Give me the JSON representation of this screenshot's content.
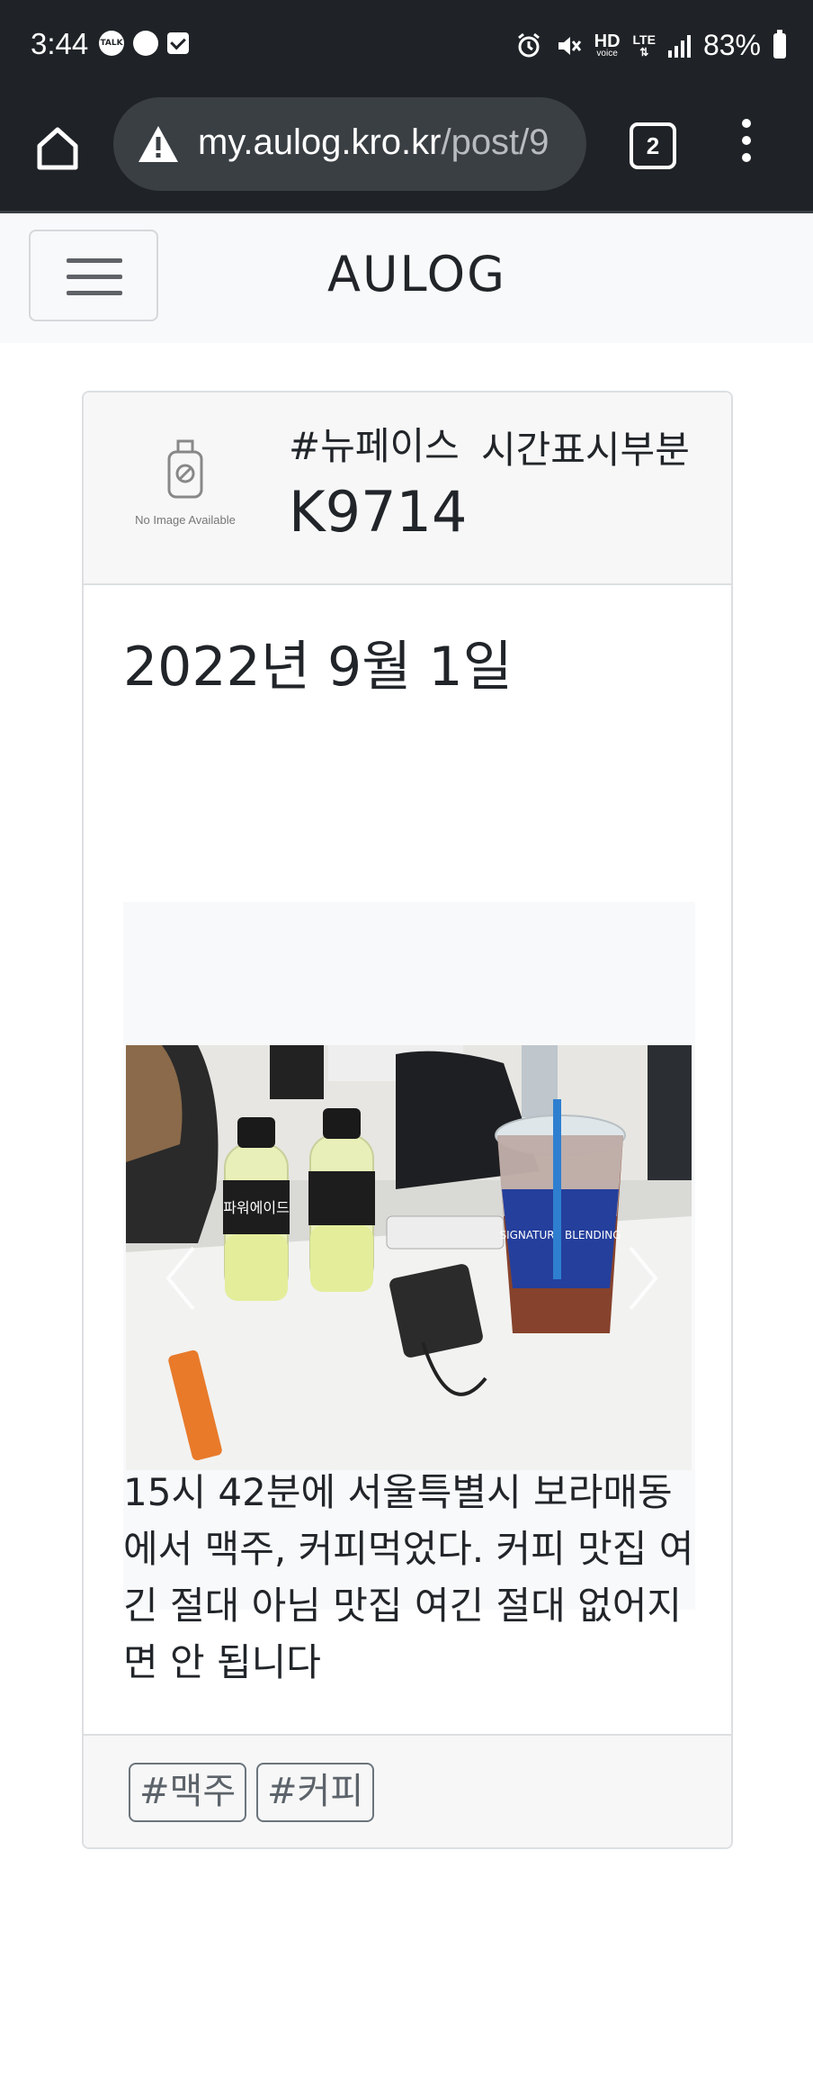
{
  "status_bar": {
    "time": "3:44",
    "talk_icon_text": "TALK",
    "hd_label": "HD",
    "voice_label": "voice",
    "lte_label": "LTE",
    "battery": "83%"
  },
  "browser": {
    "url_host": "my.aulog.kro.kr",
    "url_path": "/post/9",
    "tab_count": "2"
  },
  "navbar": {
    "brand": "AULOG"
  },
  "post": {
    "image_placeholder_text": "No Image Available",
    "hashtag": "#뉴페이스",
    "time_display": "시간표시부분",
    "username": "K9714",
    "date": "2022년 9월 1일",
    "body": "15시 42분에 서울특별시 보라매동에서 맥주, 커피먹었다. 커피 맛집 여긴 절대 아님 맛집 여긴 절대 없어지면 안 됩니다",
    "tags": [
      "#맥주",
      "#커피"
    ],
    "photo_bottle_label": "파워에이드",
    "photo_cup_label": "SIGNATURE BLENDING"
  }
}
